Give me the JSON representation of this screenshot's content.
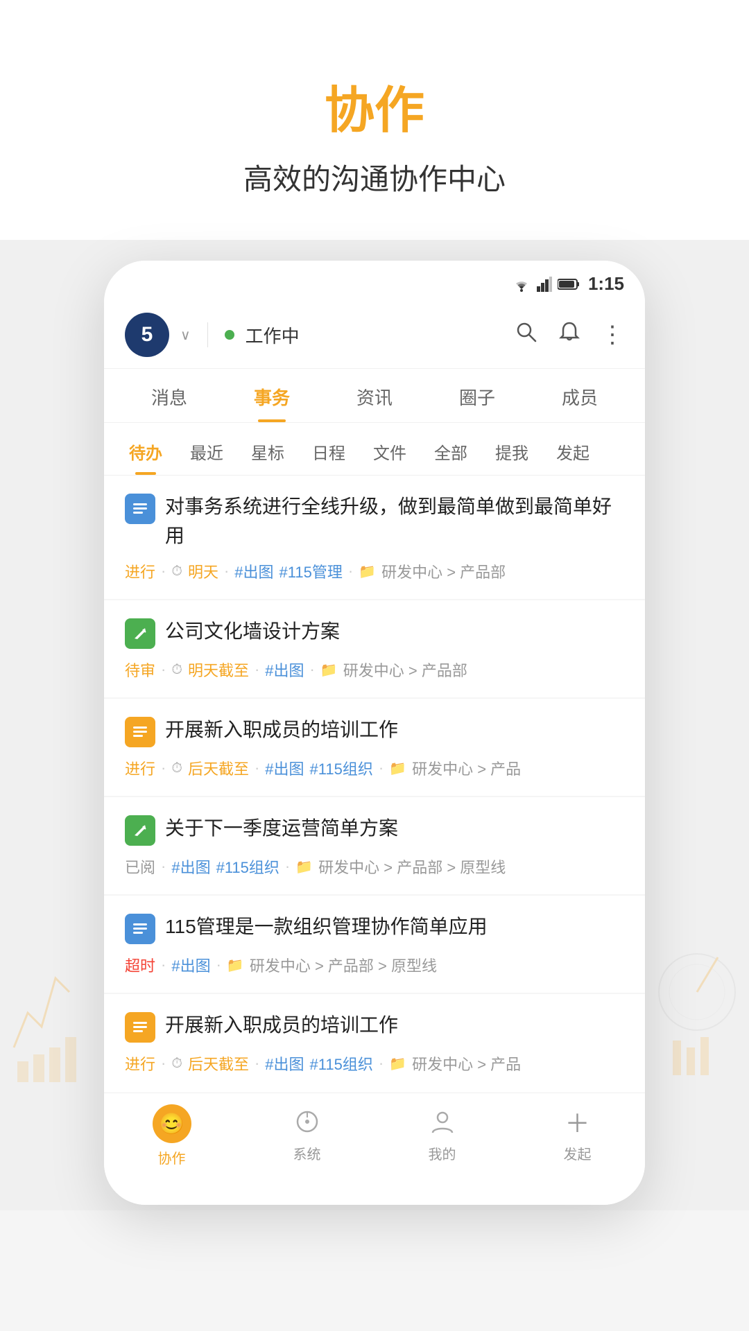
{
  "page": {
    "main_title": "协作",
    "sub_title": "高效的沟通协作中心"
  },
  "status_bar": {
    "time": "1:15"
  },
  "app_header": {
    "badge_number": "5",
    "status_label": "工作中"
  },
  "nav_tabs": [
    {
      "id": "messages",
      "label": "消息",
      "active": false
    },
    {
      "id": "tasks",
      "label": "事务",
      "active": true
    },
    {
      "id": "news",
      "label": "资讯",
      "active": false
    },
    {
      "id": "circle",
      "label": "圈子",
      "active": false
    },
    {
      "id": "members",
      "label": "成员",
      "active": false
    }
  ],
  "sub_tabs": [
    {
      "id": "pending",
      "label": "待办",
      "active": true
    },
    {
      "id": "recent",
      "label": "最近",
      "active": false
    },
    {
      "id": "starred",
      "label": "星标",
      "active": false
    },
    {
      "id": "schedule",
      "label": "日程",
      "active": false
    },
    {
      "id": "files",
      "label": "文件",
      "active": false
    },
    {
      "id": "all",
      "label": "全部",
      "active": false
    },
    {
      "id": "mention",
      "label": "提我",
      "active": false
    },
    {
      "id": "started",
      "label": "发起",
      "active": false
    }
  ],
  "tasks": [
    {
      "id": "task1",
      "icon_type": "blue",
      "icon_char": "≡",
      "title": "对事务系统进行全线升级，做到最简单做到最简单好用",
      "status": "进行",
      "status_type": "normal",
      "time_label": "明天",
      "time_icon": "⏱",
      "tags": [
        "#出图",
        "#115管理"
      ],
      "path": "研发中心 > 产品部"
    },
    {
      "id": "task2",
      "icon_type": "green",
      "icon_char": "✎",
      "title": "公司文化墙设计方案",
      "status": "待审",
      "status_type": "normal",
      "time_label": "明天截至",
      "time_icon": "⏱",
      "time_highlight": true,
      "tags": [
        "#出图"
      ],
      "path": "研发中心 > 产品部"
    },
    {
      "id": "task3",
      "icon_type": "orange",
      "icon_char": "≡",
      "title": "开展新入职成员的培训工作",
      "status": "进行",
      "status_type": "normal",
      "time_label": "后天截至",
      "time_icon": "⏱",
      "tags": [
        "#出图",
        "#115组织"
      ],
      "path": "研发中心 > 产品"
    },
    {
      "id": "task4",
      "icon_type": "green",
      "icon_char": "✎",
      "title": "关于下一季度运营简单方案",
      "status": "已阅",
      "status_type": "read",
      "time_label": "",
      "tags": [
        "#出图",
        "#115组织"
      ],
      "path": "研发中心 > 产品部 > 原型线"
    },
    {
      "id": "task5",
      "icon_type": "blue",
      "icon_char": "≡",
      "title": "115管理是一款组织管理协作简单应用",
      "status": "超时",
      "status_type": "overdue",
      "time_label": "",
      "tags": [
        "#出图"
      ],
      "path": "研发中心 > 产品部 > 原型线"
    },
    {
      "id": "task6",
      "icon_type": "orange",
      "icon_char": "≡",
      "title": "开展新入职成员的培训工作",
      "status": "进行",
      "status_type": "normal",
      "time_label": "后天截至",
      "time_icon": "⏱",
      "tags": [
        "#出图",
        "#115组织"
      ],
      "path": "研发中心 > 产品"
    }
  ],
  "bottom_nav": [
    {
      "id": "collab",
      "label": "协作",
      "active": true,
      "icon": "😊"
    },
    {
      "id": "system",
      "label": "系统",
      "active": false,
      "icon": "⊕"
    },
    {
      "id": "mine",
      "label": "我的",
      "active": false,
      "icon": "👤"
    },
    {
      "id": "create",
      "label": "发起",
      "active": false,
      "icon": "+"
    }
  ]
}
